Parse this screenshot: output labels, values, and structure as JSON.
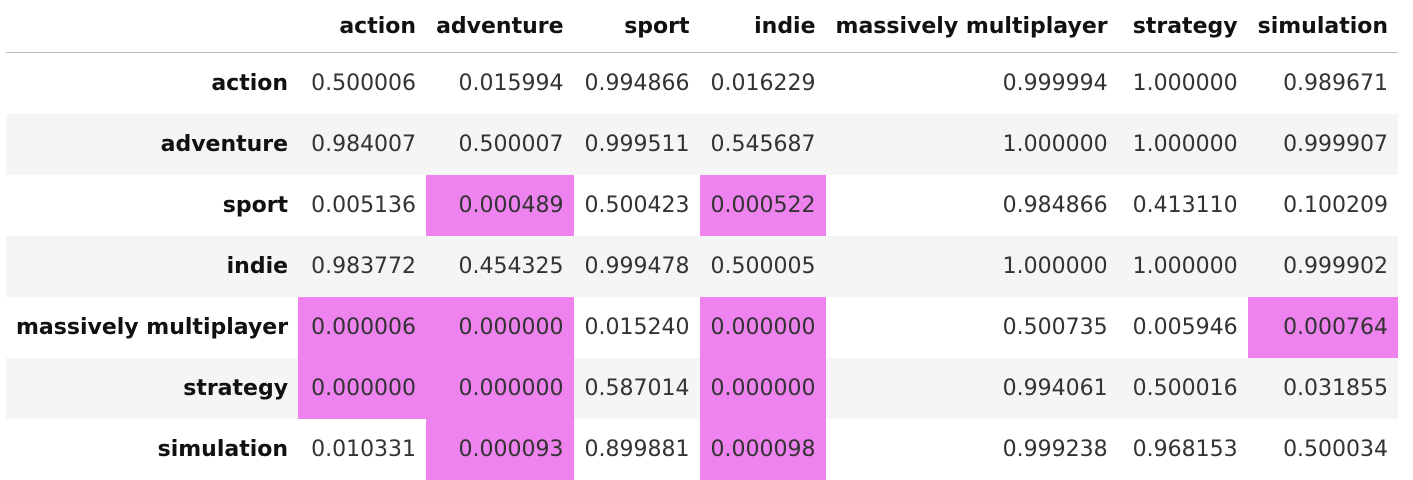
{
  "table": {
    "columns": [
      "action",
      "adventure",
      "sport",
      "indie",
      "massively multiplayer",
      "strategy",
      "simulation"
    ],
    "highlight_color": "#ee82ee",
    "rows": [
      {
        "label": "action",
        "cells": [
          "0.500006",
          "0.015994",
          "0.994866",
          "0.016229",
          "0.999994",
          "1.000000",
          "0.989671"
        ],
        "highlight": [
          false,
          false,
          false,
          false,
          false,
          false,
          false
        ]
      },
      {
        "label": "adventure",
        "cells": [
          "0.984007",
          "0.500007",
          "0.999511",
          "0.545687",
          "1.000000",
          "1.000000",
          "0.999907"
        ],
        "highlight": [
          false,
          false,
          false,
          false,
          false,
          false,
          false
        ]
      },
      {
        "label": "sport",
        "cells": [
          "0.005136",
          "0.000489",
          "0.500423",
          "0.000522",
          "0.984866",
          "0.413110",
          "0.100209"
        ],
        "highlight": [
          false,
          true,
          false,
          true,
          false,
          false,
          false
        ]
      },
      {
        "label": "indie",
        "cells": [
          "0.983772",
          "0.454325",
          "0.999478",
          "0.500005",
          "1.000000",
          "1.000000",
          "0.999902"
        ],
        "highlight": [
          false,
          false,
          false,
          false,
          false,
          false,
          false
        ]
      },
      {
        "label": "massively multiplayer",
        "cells": [
          "0.000006",
          "0.000000",
          "0.015240",
          "0.000000",
          "0.500735",
          "0.005946",
          "0.000764"
        ],
        "highlight": [
          true,
          true,
          false,
          true,
          false,
          false,
          true
        ]
      },
      {
        "label": "strategy",
        "cells": [
          "0.000000",
          "0.000000",
          "0.587014",
          "0.000000",
          "0.994061",
          "0.500016",
          "0.031855"
        ],
        "highlight": [
          true,
          true,
          false,
          true,
          false,
          false,
          false
        ]
      },
      {
        "label": "simulation",
        "cells": [
          "0.010331",
          "0.000093",
          "0.899881",
          "0.000098",
          "0.999238",
          "0.968153",
          "0.500034"
        ],
        "highlight": [
          false,
          true,
          false,
          true,
          false,
          false,
          false
        ]
      }
    ]
  }
}
